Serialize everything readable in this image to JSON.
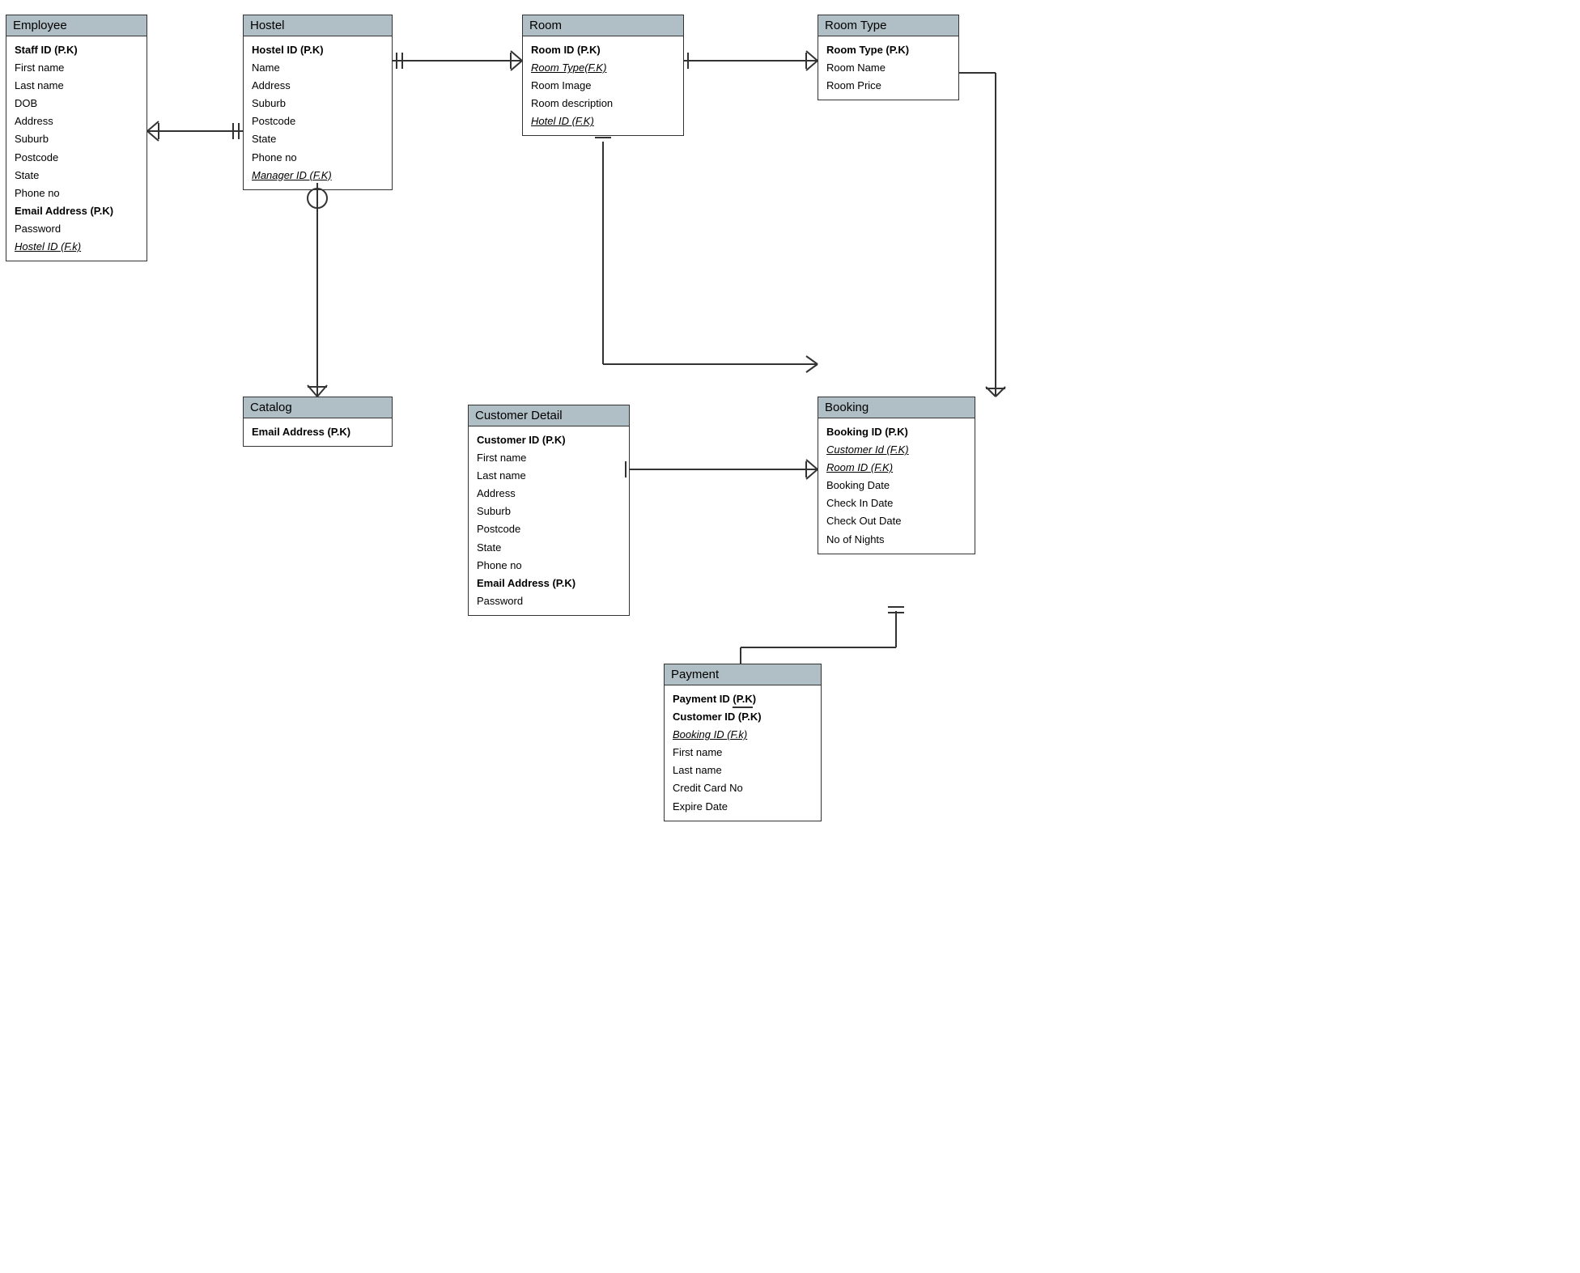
{
  "entities": {
    "employee": {
      "title": "Employee",
      "fields": [
        {
          "text": "Staff ID (P.K)",
          "style": "pk"
        },
        {
          "text": "First name",
          "style": "normal"
        },
        {
          "text": "Last name",
          "style": "normal"
        },
        {
          "text": "DOB",
          "style": "normal"
        },
        {
          "text": "Address",
          "style": "normal"
        },
        {
          "text": "Suburb",
          "style": "normal"
        },
        {
          "text": "Postcode",
          "style": "normal"
        },
        {
          "text": "State",
          "style": "normal"
        },
        {
          "text": "Phone no",
          "style": "normal"
        },
        {
          "text": "Email Address (P.K)",
          "style": "pk"
        },
        {
          "text": "Password",
          "style": "normal"
        },
        {
          "text": "Hostel ID (F.k)",
          "style": "fk"
        }
      ]
    },
    "hostel": {
      "title": "Hostel",
      "fields": [
        {
          "text": "Hostel ID (P.K)",
          "style": "pk"
        },
        {
          "text": "Name",
          "style": "normal"
        },
        {
          "text": "Address",
          "style": "normal"
        },
        {
          "text": "Suburb",
          "style": "normal"
        },
        {
          "text": "Postcode",
          "style": "normal"
        },
        {
          "text": "State",
          "style": "normal"
        },
        {
          "text": "Phone no",
          "style": "normal"
        },
        {
          "text": "Manager ID (F.K)",
          "style": "fk"
        }
      ]
    },
    "room": {
      "title": "Room",
      "fields": [
        {
          "text": "Room ID (P.K)",
          "style": "pk"
        },
        {
          "text": "Room Type(F.K)",
          "style": "fk"
        },
        {
          "text": "Room Image",
          "style": "normal"
        },
        {
          "text": "Room description",
          "style": "normal"
        },
        {
          "text": "Hotel ID (F.K)",
          "style": "fk"
        }
      ]
    },
    "roomtype": {
      "title": "Room Type",
      "fields": [
        {
          "text": "Room Type (P.K)",
          "style": "pk"
        },
        {
          "text": "Room Name",
          "style": "normal"
        },
        {
          "text": "Room Price",
          "style": "normal"
        }
      ]
    },
    "catalog": {
      "title": "Catalog",
      "fields": [
        {
          "text": "Email Address (P.K)",
          "style": "pk"
        }
      ]
    },
    "customerdetail": {
      "title": "Customer Detail",
      "fields": [
        {
          "text": "Customer ID (P.K)",
          "style": "pk"
        },
        {
          "text": "First name",
          "style": "normal"
        },
        {
          "text": "Last name",
          "style": "normal"
        },
        {
          "text": "Address",
          "style": "normal"
        },
        {
          "text": "Suburb",
          "style": "normal"
        },
        {
          "text": "Postcode",
          "style": "normal"
        },
        {
          "text": "State",
          "style": "normal"
        },
        {
          "text": "Phone no",
          "style": "normal"
        },
        {
          "text": "Email Address (P.K)",
          "style": "pk"
        },
        {
          "text": "Password",
          "style": "normal"
        }
      ]
    },
    "booking": {
      "title": "Booking",
      "fields": [
        {
          "text": "Booking ID (P.K)",
          "style": "pk"
        },
        {
          "text": "Customer Id (F.K)",
          "style": "fk"
        },
        {
          "text": "Room ID (F.K)",
          "style": "fk"
        },
        {
          "text": "Booking Date",
          "style": "normal"
        },
        {
          "text": "Check In Date",
          "style": "normal"
        },
        {
          "text": "Check Out Date",
          "style": "normal"
        },
        {
          "text": "No of Nights",
          "style": "normal"
        }
      ]
    },
    "payment": {
      "title": "Payment",
      "fields": [
        {
          "text": "Payment ID (P.K)",
          "style": "pk"
        },
        {
          "text": "Customer ID (P.K)",
          "style": "pk"
        },
        {
          "text": "Booking ID (F.k)",
          "style": "fk"
        },
        {
          "text": "First name",
          "style": "normal"
        },
        {
          "text": "Last name",
          "style": "normal"
        },
        {
          "text": "Credit Card No",
          "style": "normal"
        },
        {
          "text": "Expire Date",
          "style": "normal"
        }
      ]
    }
  }
}
